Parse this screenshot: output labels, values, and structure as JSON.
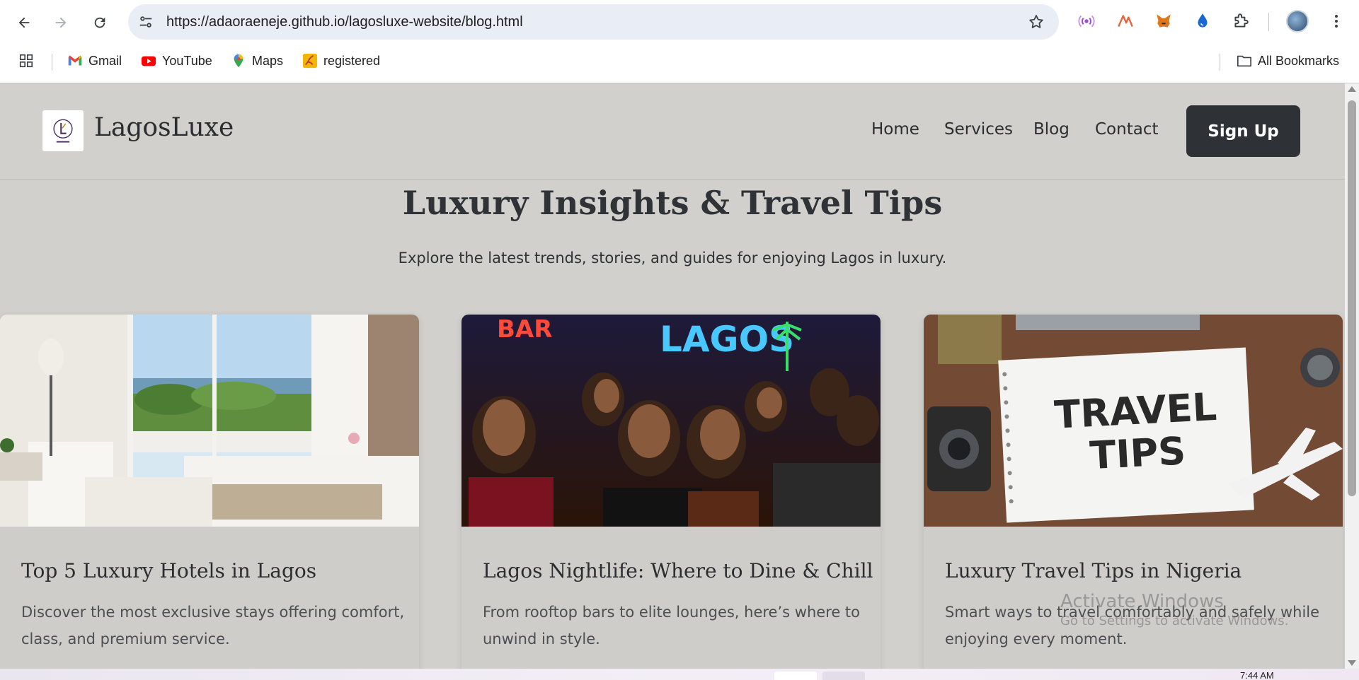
{
  "browser": {
    "url": "https://adaoraeneje.github.io/lagosluxe-website/blog.html",
    "bookmarks": [
      {
        "label": "Gmail",
        "icon": "gmail-icon"
      },
      {
        "label": "YouTube",
        "icon": "youtube-icon"
      },
      {
        "label": "Maps",
        "icon": "maps-icon"
      },
      {
        "label": "registered",
        "icon": "registered-icon"
      }
    ],
    "all_bookmarks_label": "All Bookmarks"
  },
  "site": {
    "brand": "LagosLuxe",
    "nav": [
      "Home",
      "Services",
      "Blog",
      "Contact"
    ],
    "signup_label": "Sign Up"
  },
  "hero": {
    "title": "Luxury Insights & Travel Tips",
    "subtitle": "Explore the latest trends, stories, and guides for enjoying Lagos in luxury."
  },
  "posts": [
    {
      "title": "Top 5 Luxury Hotels in Lagos",
      "description": "Discover the most exclusive stays offering comfort, class, and premium service.",
      "image": "luxury-hotel-room-photo"
    },
    {
      "title": "Lagos Nightlife: Where to Dine & Chill",
      "description": "From rooftop bars to elite lounges, here’s where to unwind in style.",
      "image": "nightlife-crowd-photo",
      "image_signs": [
        "BAR",
        "LAGOS"
      ]
    },
    {
      "title": "Luxury Travel Tips in Nigeria",
      "description": "Smart ways to travel comfortably and safely while enjoying every moment.",
      "image": "travel-tips-notebook-photo",
      "image_text": [
        "TRAVEL",
        "TIPS"
      ]
    }
  ],
  "watermark": {
    "line1": "Activate Windows",
    "line2": "Go to Settings to activate Windows."
  },
  "taskbar": {
    "clock": "7:44 AM"
  },
  "colors": {
    "page_bg": "#d1d0cc",
    "text_dark": "#2b2d30",
    "button_bg": "#2e3236"
  }
}
